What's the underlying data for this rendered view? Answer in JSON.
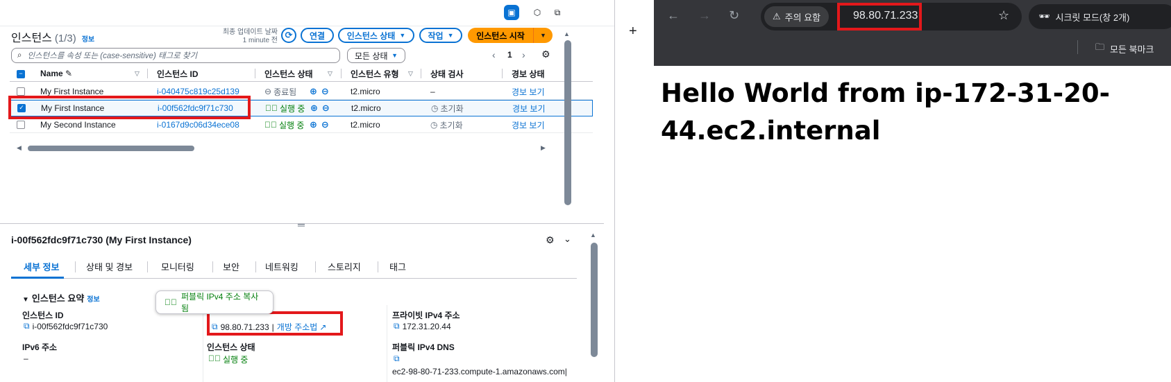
{
  "console": {
    "header": {
      "title": "인스턴스",
      "count": "(1/3)",
      "info": "정보",
      "last_updated_label": "최종 업데이트 날짜",
      "last_updated_value": "1 minute 전",
      "connect": "연결",
      "instance_state": "인스턴스 상태",
      "actions": "작업",
      "launch": "인스턴스 시작"
    },
    "search_placeholder": "인스턴스를 속성 또는 (case-sensitive) 태그로 찾기",
    "state_filter": "모든 상태",
    "page_number": "1",
    "columns": [
      "Name",
      "인스턴스 ID",
      "인스턴스 상태",
      "인스턴스 유형",
      "상태 검사",
      "경보 상태"
    ],
    "rows": [
      {
        "name": "My First Instance",
        "id": "i-040475c819c25d139",
        "state": "종료됨",
        "type": "t2.micro",
        "check": "–",
        "alarm": "경보 보기",
        "selected": false
      },
      {
        "name": "My First Instance",
        "id": "i-00f562fdc9f71c730",
        "state": "실행 중",
        "type": "t2.micro",
        "check": "초기화",
        "alarm": "경보 보기",
        "selected": true
      },
      {
        "name": "My Second Instance",
        "id": "i-0167d9c06d34ece08",
        "state": "실행 중",
        "type": "t2.micro",
        "check": "초기화",
        "alarm": "경보 보기",
        "selected": false
      }
    ],
    "detail": {
      "title": "i-00f562fdc9f71c730 (My First Instance)",
      "tabs": [
        "세부 정보",
        "상태 및 경보",
        "모니터링",
        "보안",
        "네트워킹",
        "스토리지",
        "태그"
      ],
      "summary_title": "인스턴스 요약",
      "summary_info": "정보",
      "toast": "퍼블릭 IPv4 주소 복사됨",
      "instance_id_label": "인스턴스 ID",
      "instance_id": "i-00f562fdc9f71c730",
      "public_ip": "98.80.71.233",
      "open_address": "개방 주소법",
      "private_ip_label": "프라이빗 IPv4 주소",
      "private_ip": "172.31.20.44",
      "ipv6_label": "IPv6 주소",
      "ipv6": "–",
      "instance_state_label": "인스턴스 상태",
      "instance_state": "실행 중",
      "public_dns_label": "퍼블릭 IPv4 DNS",
      "public_dns": "ec2-98-80-71-233.compute-1.amazonaws.com|"
    }
  },
  "browser": {
    "warning": "주의 요함",
    "url": "98.80.71.233",
    "incognito": "시크릿 모드(창 2개)",
    "bookmarks": "모든 북마크",
    "page_heading": "Hello World from ip-172-31-20-44.ec2.internal"
  },
  "colors": {
    "accent": "#0972d3",
    "primary": "#ff9900",
    "highlight": "#e3181b",
    "running": "#037f0c"
  }
}
